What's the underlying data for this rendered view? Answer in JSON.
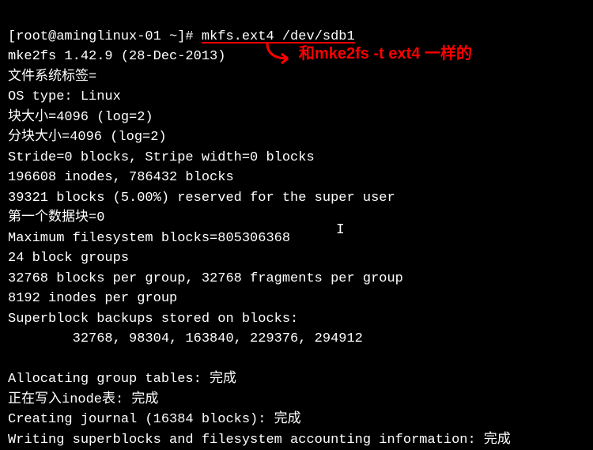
{
  "prompt": {
    "user_host": "[root@aminglinux-01 ~]# ",
    "command": "mkfs.ext4 /dev/sdb1"
  },
  "output": {
    "line1": "mke2fs 1.42.9 (28-Dec-2013)",
    "line2": "文件系统标签=",
    "line3": "OS type: Linux",
    "line4": "块大小=4096 (log=2)",
    "line5": "分块大小=4096 (log=2)",
    "line6": "Stride=0 blocks, Stripe width=0 blocks",
    "line7": "196608 inodes, 786432 blocks",
    "line8": "39321 blocks (5.00%) reserved for the super user",
    "line9": "第一个数据块=0",
    "line10": "Maximum filesystem blocks=805306368",
    "line11": "24 block groups",
    "line12": "32768 blocks per group, 32768 fragments per group",
    "line13": "8192 inodes per group",
    "line14": "Superblock backups stored on blocks:",
    "line15": "        32768, 98304, 163840, 229376, 294912",
    "line16": "",
    "line17": "Allocating group tables: 完成",
    "line18": "正在写入inode表: 完成",
    "line19": "Creating journal (16384 blocks): 完成",
    "line20": "Writing superblocks and filesystem accounting information: 完成"
  },
  "annotation": {
    "text": "和mke2fs -t ext4 一样的",
    "color": "#ff0000"
  }
}
